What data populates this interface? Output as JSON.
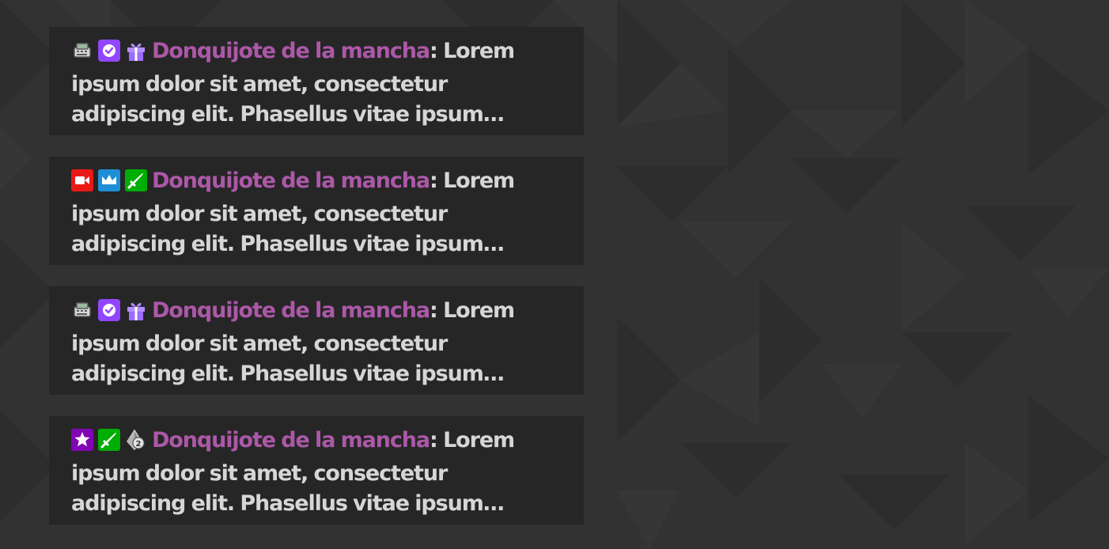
{
  "messages": [
    {
      "badges": [
        "cash-register-icon",
        "verified-icon",
        "gift-icon"
      ],
      "username": "Donquijote de la mancha",
      "separator": ":",
      "text": "Lorem ipsum dolor sit amet, consectetur adipiscing elit. Phasellus vitae ipsum facilisis, rhoncus..."
    },
    {
      "badges": [
        "broadcaster-camera-icon",
        "crown-icon",
        "moderator-sword-icon"
      ],
      "username": "Donquijote de la mancha",
      "separator": ":",
      "text": "Lorem ipsum dolor sit amet, consectetur adipiscing elit. Phasellus vitae ipsum facilisis, rhoncus..."
    },
    {
      "badges": [
        "cash-register-icon",
        "verified-icon",
        "gift-icon"
      ],
      "username": "Donquijote de la mancha",
      "separator": ":",
      "text": "Lorem ipsum dolor sit amet, consectetur adipiscing elit. Phasellus vitae ipsum facilisis, rhoncus..."
    },
    {
      "badges": [
        "star-icon",
        "moderator-sword-icon",
        "level-gem-icon"
      ],
      "username": "Donquijote de la mancha",
      "separator": ":",
      "text": "Lorem ipsum dolor sit amet, consectetur adipiscing elit. Phasellus vitae ipsum facilisis, rhoncus..."
    }
  ],
  "gem_level": "2",
  "colors": {
    "background": "#323232",
    "card": "#262626",
    "text": "#d6d6d6",
    "username": "#ac58a8",
    "verified": "#9146ff",
    "gift": "#9c6bff",
    "camera": "#e91916",
    "crown": "#1e8fd6",
    "moderator": "#00ad03",
    "star": "#8205b4"
  }
}
